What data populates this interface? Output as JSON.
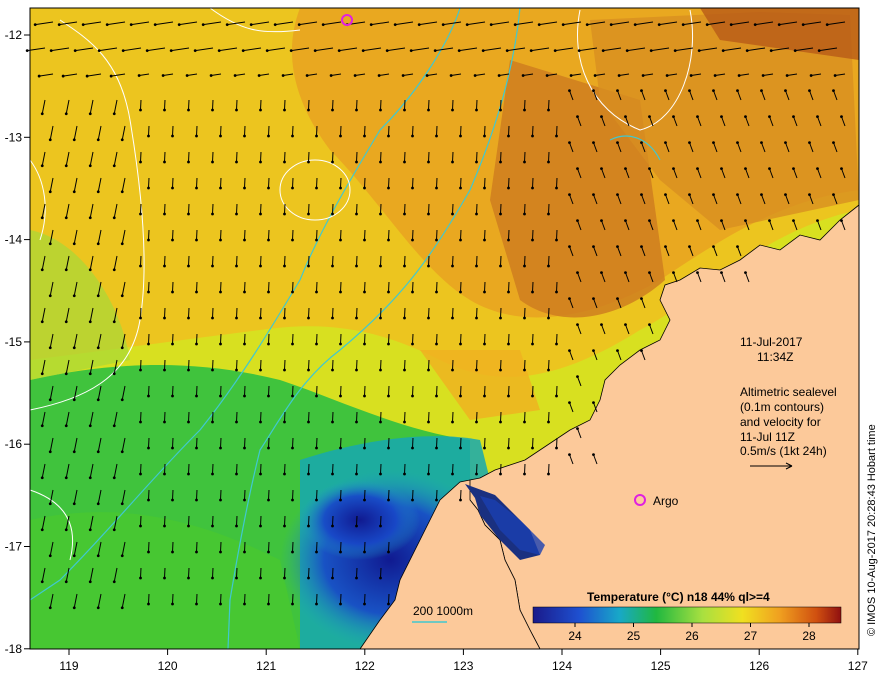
{
  "map": {
    "x_ticks": [
      "119",
      "120",
      "121",
      "122",
      "123",
      "124",
      "125",
      "126",
      "127"
    ],
    "y_ticks": [
      "-12",
      "-13",
      "-14",
      "-15",
      "-16",
      "-17",
      "-18"
    ],
    "date": "11-Jul-2017",
    "time": "11:34Z",
    "legend_lines": [
      "Altimetric sealevel",
      "(0.1m contours)",
      "and velocity for",
      "11-Jul 11Z",
      "0.5m/s (1kt 24h)"
    ],
    "argo_label": "Argo",
    "bathymetry_legend": "200 1000m",
    "colorbar_title": "Temperature (°C) n18 44% ql>=4",
    "colorbar_ticks": [
      "24",
      "25",
      "26",
      "27",
      "28"
    ],
    "credit": "© IMOS 10-Aug-2017 20:28:43 Hobart time",
    "colors": {
      "land": "#fcc99a",
      "bathymetry": "#40c8d0",
      "argo": "#e020e0",
      "contour": "#ffffff"
    }
  }
}
